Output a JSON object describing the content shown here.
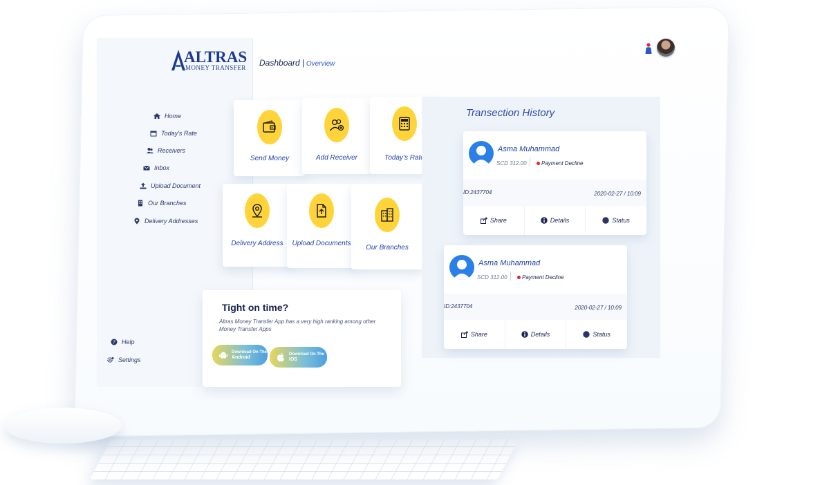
{
  "brand": {
    "name": "ALTRAS",
    "tagline": "MONEY TRANSFER"
  },
  "header": {
    "title": "Dashboard",
    "separator": "|",
    "subtitle": "Overview"
  },
  "sidebar": {
    "items": [
      {
        "label": "Home",
        "icon": "home-icon"
      },
      {
        "label": "Today's Rate",
        "icon": "calendar-icon"
      },
      {
        "label": "Receivers",
        "icon": "users-icon"
      },
      {
        "label": "Inbox",
        "icon": "envelope-icon"
      },
      {
        "label": "Upload Document",
        "icon": "upload-icon"
      },
      {
        "label": "Our Branches",
        "icon": "building-icon"
      },
      {
        "label": "Delivery Addresses",
        "icon": "location-pin-icon"
      }
    ],
    "footer": [
      {
        "label": "Help",
        "icon": "help-icon"
      },
      {
        "label": "Settings",
        "icon": "settings-icon"
      }
    ]
  },
  "tiles": [
    {
      "label": "Send Money",
      "icon": "wallet-icon"
    },
    {
      "label": "Add Receiver",
      "icon": "add-user-icon"
    },
    {
      "label": "Today's Rate",
      "icon": "calculator-icon"
    },
    {
      "label": "Delivery Address",
      "icon": "location-pin-icon"
    },
    {
      "label": "Upload Documents",
      "icon": "upload-file-icon"
    },
    {
      "label": "Our Branches",
      "icon": "buildings-icon"
    }
  ],
  "promo": {
    "title": "Tight on time?",
    "text": "Altras Money Transfer App has a very high ranking among other Money Transfer Apps",
    "android": {
      "line1": "Download On The",
      "line2": "Android"
    },
    "ios": {
      "line1": "Download On The",
      "line2": "IOS"
    }
  },
  "transactions": {
    "title": "Transection History",
    "items": [
      {
        "name": "Asma Muhammad",
        "amount": "SCD 312.00",
        "status": "Payment Decline",
        "id": "ID:2437704",
        "date": "2020-02-27 / 10:09"
      },
      {
        "name": "Asma Muhammad",
        "amount": "SCD 312.00",
        "status": "Payment Decline",
        "id": "ID:2437704",
        "date": "2020-02-27 / 10:09"
      }
    ],
    "actions": {
      "share": "Share",
      "details": "Details",
      "status": "Status"
    }
  },
  "colors": {
    "accent": "#ffd43b",
    "primary": "#2243a8",
    "decline": "#e0262d",
    "avatar": "#2a7fe8"
  }
}
